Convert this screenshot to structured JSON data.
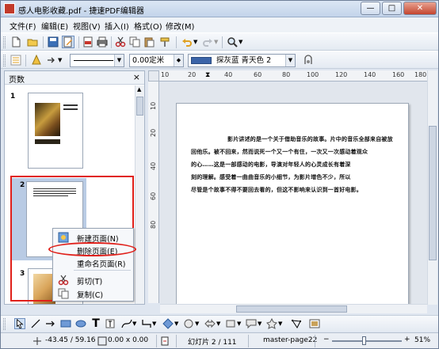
{
  "window": {
    "title": "感人电影收藏.pdf - 捷速PDF编辑器",
    "minimize_label": "—",
    "maximize_label": "□",
    "close_label": "✕"
  },
  "menubar": {
    "items": [
      {
        "label": "文件(F)"
      },
      {
        "label": "编辑(E)"
      },
      {
        "label": "视图(V)"
      },
      {
        "label": "插入(I)"
      },
      {
        "label": "格式(O)"
      },
      {
        "label": "修改(M)"
      }
    ]
  },
  "toolbar2": {
    "line_width": "0.00定米",
    "fill_style": "探灰蓝 青天色 2"
  },
  "pages_panel": {
    "title": "页数",
    "close_label": "×",
    "pages": [
      {
        "number": "1"
      },
      {
        "number": "2"
      },
      {
        "number": "3"
      }
    ]
  },
  "context_menu": {
    "items": [
      {
        "label": "新建页面(N)",
        "icon": "new-page-icon"
      },
      {
        "label": "删除页面(E)",
        "icon": ""
      },
      {
        "label": "重命名页面(R)",
        "icon": ""
      },
      {
        "label": "剪切(T)",
        "icon": "scissors-icon"
      },
      {
        "label": "复制(C)",
        "icon": "copy-icon"
      }
    ],
    "highlighted": "删除页面(E)"
  },
  "ruler": {
    "h_labels": [
      "10",
      "20",
      "40",
      "60",
      "80",
      "100",
      "120",
      "140",
      "160",
      "180"
    ],
    "v_labels": [
      "10",
      "20",
      "40",
      "60",
      "80"
    ]
  },
  "document": {
    "lines": [
      "影片讲述的是一个关于借助音乐的故事。片中的音乐全部来自被放",
      "回他乐。被不回来，然而说死一个又一个有住，一次又一次感动着观众",
      "的心……这是一部感动的电影，导演对年轻人的心灵成长有着深",
      "刻的理解。感受着一曲曲音乐的小细节，为影片增色不少，所以",
      "尽管是个故事不得不要回去看的，但这不影响来认识到一首好电影。"
    ]
  },
  "statusbar": {
    "position": "-43.45 / 59.16",
    "size": "0.00 x 0.00",
    "slide": "幻灯片 2 / 111",
    "master": "master-page22",
    "zoom": "51%",
    "zoom_level": 0.51
  },
  "colors": {
    "annotation_red": "#e0201a",
    "fill_swatch": "#3b64a8",
    "selection": "#b9cbe4"
  }
}
